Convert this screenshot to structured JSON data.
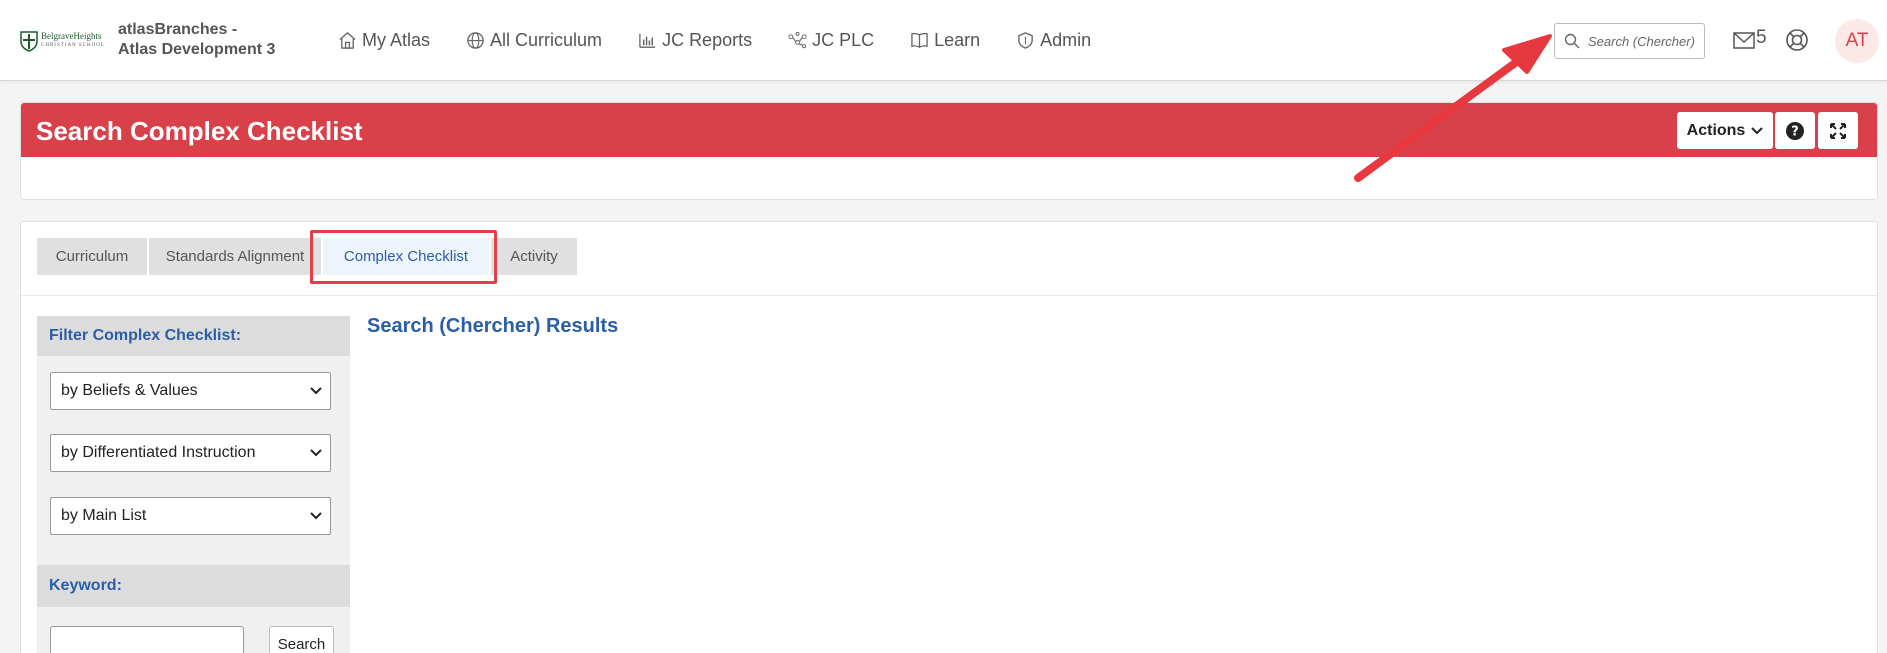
{
  "app": {
    "logo_text": "BelgraveHeights",
    "logo_subtext": "CHRISTIAN SCHOOL",
    "site_title": "atlasBranches - Atlas Development 3"
  },
  "nav": {
    "items": [
      {
        "label": "My Atlas",
        "icon": "home-icon"
      },
      {
        "label": "All Curriculum",
        "icon": "globe-icon"
      },
      {
        "label": "JC Reports",
        "icon": "bar-chart-icon"
      },
      {
        "label": "JC PLC",
        "icon": "network-icon"
      },
      {
        "label": "Learn",
        "icon": "book-icon"
      },
      {
        "label": "Admin",
        "icon": "shield-icon"
      }
    ],
    "search_placeholder": "Search (Chercher)",
    "mail_count": "5",
    "avatar_initials": "AT"
  },
  "header": {
    "title": "Search Complex Checklist",
    "actions_label": "Actions"
  },
  "tabs": [
    {
      "label": "Curriculum",
      "active": false
    },
    {
      "label": "Standards Alignment",
      "active": false
    },
    {
      "label": "Complex Checklist",
      "active": true
    },
    {
      "label": "Activity",
      "active": false
    }
  ],
  "sidebar": {
    "filter_heading": "Filter Complex Checklist:",
    "filters": [
      {
        "selected": "by Beliefs & Values"
      },
      {
        "selected": "by Differentiated Instruction"
      },
      {
        "selected": "by Main List"
      }
    ],
    "keyword_heading": "Keyword:",
    "keyword_value": "",
    "search_button": "Search"
  },
  "results": {
    "title": "Search (Chercher) Results"
  },
  "colors": {
    "brand_red": "#d9414a",
    "link_blue": "#2a5ea8",
    "annotation_red": "#e8383f"
  }
}
